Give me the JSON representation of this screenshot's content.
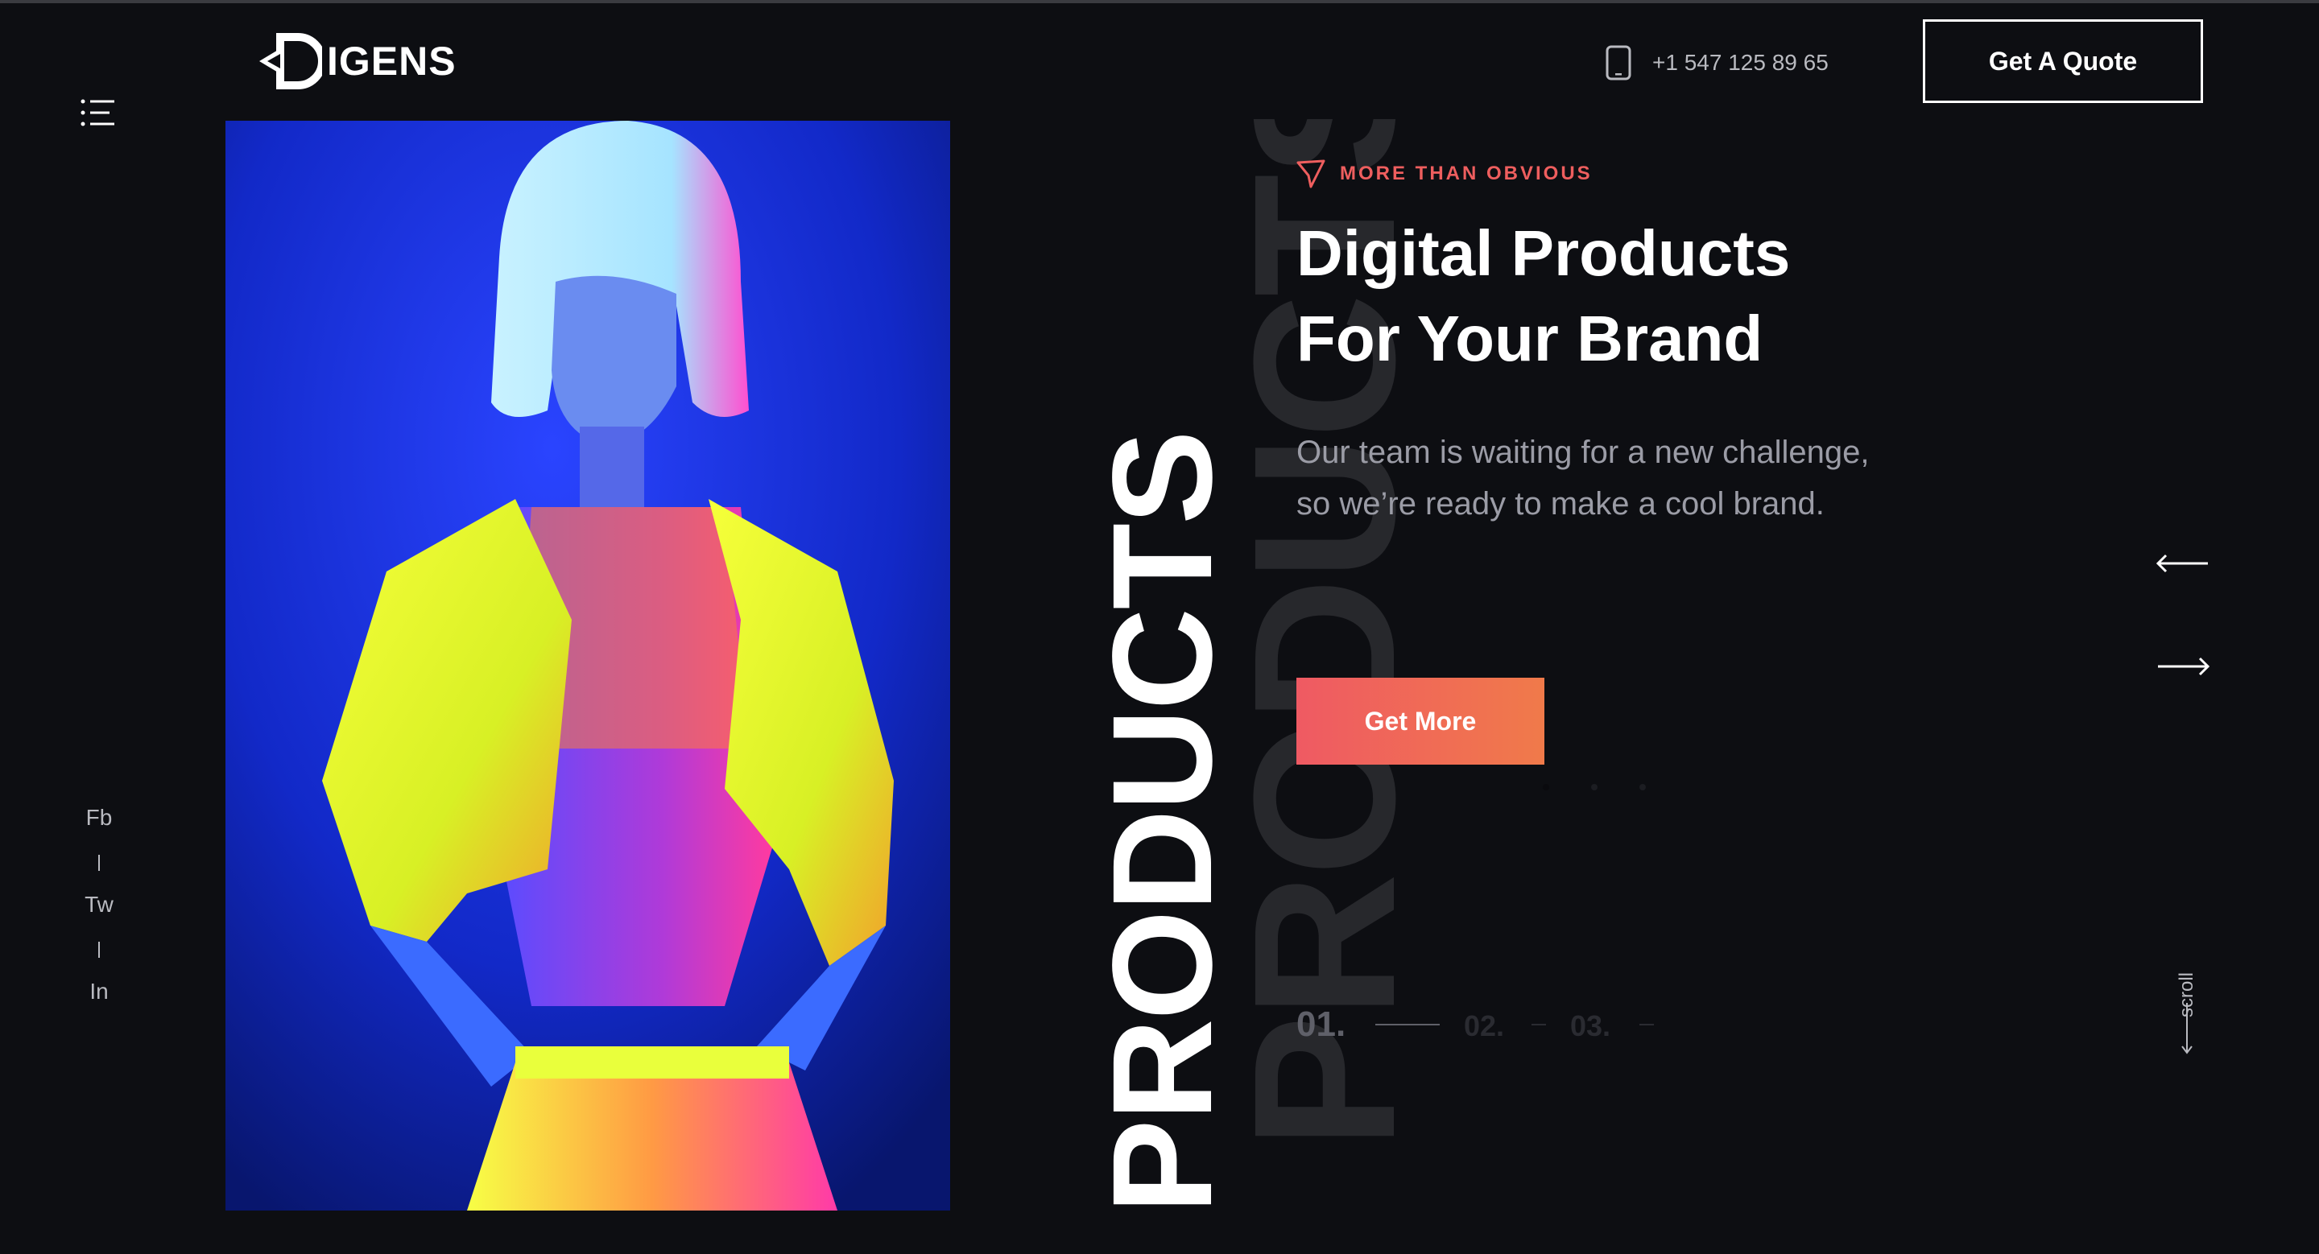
{
  "brand": {
    "name": "IGENS",
    "logo_icon": "brand-d-logo",
    "accent_color": "#ee5e5e"
  },
  "header": {
    "phone_icon": "phone-icon",
    "phone": "+1 547 125 89 65",
    "quote_button": "Get A Quote"
  },
  "nav": {
    "menu_icon": "menu-list-icon"
  },
  "hero": {
    "vertical_word": "PRODUCTS",
    "ghost_word": "PRODUCTS",
    "eyebrow_icon": "paper-plane-icon",
    "eyebrow": "MORE THAN OBVIOUS",
    "headline_line1": "Digital Products",
    "headline_line2": "For Your Brand",
    "description": "Our team is waiting for a new challenge, so we’re ready to make a cool brand.",
    "cta": "Get More",
    "image": "neon-fashion-model-photo"
  },
  "slider": {
    "numbers": [
      "01.",
      "02.",
      "03."
    ],
    "active_index": 0,
    "prev_icon": "arrow-left-icon",
    "next_icon": "arrow-right-icon"
  },
  "social": [
    "Fb",
    "Tw",
    "In"
  ],
  "scroll": {
    "label": "scroll",
    "icon": "arrow-down-icon"
  }
}
